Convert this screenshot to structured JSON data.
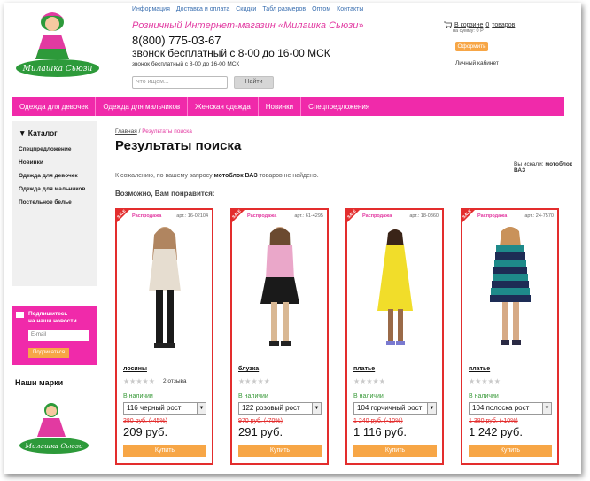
{
  "top_links": [
    "Информация",
    "Доставка и оплата",
    "Скидки",
    "Табл размеров",
    "Оптом",
    "Контакты"
  ],
  "header": {
    "brand": "Милашка Сьюзи",
    "shop_title": "Розничный Интернет-магазин «Милашка Сьюзи»",
    "phone": "8(800) 775-03-67",
    "call_note": "звонок бесплатный с 8-00 до 16-00 МСК",
    "call_note_small": "звонок бесплатный с 8-00 до 16-00 МСК",
    "search_placeholder": "что ищем...",
    "search_button": "Найти"
  },
  "cart": {
    "label": "В корзине",
    "count": "0",
    "unit": "товаров",
    "sum_label": "на сумму: 0 Р",
    "checkout": "Оформить",
    "cabinet": "Личный кабинет"
  },
  "main_nav": [
    "Одежда для девочек",
    "Одежда для мальчиков",
    "Женская одежда",
    "Новинки",
    "Спецпредложения"
  ],
  "sidebar": {
    "catalog_title": "Каталог",
    "items": [
      "Спецпредложение",
      "Новинки",
      "Одежда для девочек",
      "Одежда для мальчиков",
      "Постельное белье"
    ]
  },
  "newsletter": {
    "title_line1": "Подпишитесь",
    "title_line2": "на наши новости",
    "email_placeholder": "E-mail",
    "button": "Подписаться"
  },
  "brands_title": "Наши марки",
  "breadcrumb": {
    "home": "Главная",
    "separator": "/",
    "current": "Результаты поиска"
  },
  "page_title": "Результаты поиска",
  "search_info": {
    "you_searched_label": "Вы искали:",
    "query": "мотоблок ВАЗ",
    "notfound_before": "К сожалению, по вашему запросу",
    "notfound_after": "товаров не найдено."
  },
  "maybe_title": "Возможно, Вам понравится:",
  "sale_badge": "SALE",
  "products": [
    {
      "tag": "Распродажа",
      "sku": "арт.: 16-02104",
      "name": "лосины",
      "reviews": "2 отзыва",
      "stock": "В наличии",
      "size": "116 черный рост",
      "old_price": "380 руб. (-45%)",
      "price": "209 руб.",
      "buy": "Купить"
    },
    {
      "tag": "Распродажа",
      "sku": "арт.: 61-4295",
      "name": "блузка",
      "reviews": "",
      "stock": "В наличии",
      "size": "122 розовый рост",
      "old_price": "970 руб. (-70%)",
      "price": "291 руб.",
      "buy": "Купить"
    },
    {
      "tag": "Распродажа",
      "sku": "арт.: 18-0860",
      "name": "платье",
      "reviews": "",
      "stock": "В наличии",
      "size": "104 горчичный рост",
      "old_price": "1 240 руб. (-10%)",
      "price": "1 116 руб.",
      "buy": "Купить"
    },
    {
      "tag": "Распродажа",
      "sku": "арт.: 24-7570",
      "name": "платье",
      "reviews": "",
      "stock": "В наличии",
      "size": "104 полоска рост",
      "old_price": "1 380 руб. (-10%)",
      "price": "1 242 руб.",
      "buy": "Купить"
    }
  ],
  "colors": {
    "accent_pink": "#f02aaa",
    "button_orange": "#f7a646",
    "sale_red": "#e32d2d",
    "link_blue": "#3a6fb0",
    "stock_green": "#3a9a3a"
  }
}
